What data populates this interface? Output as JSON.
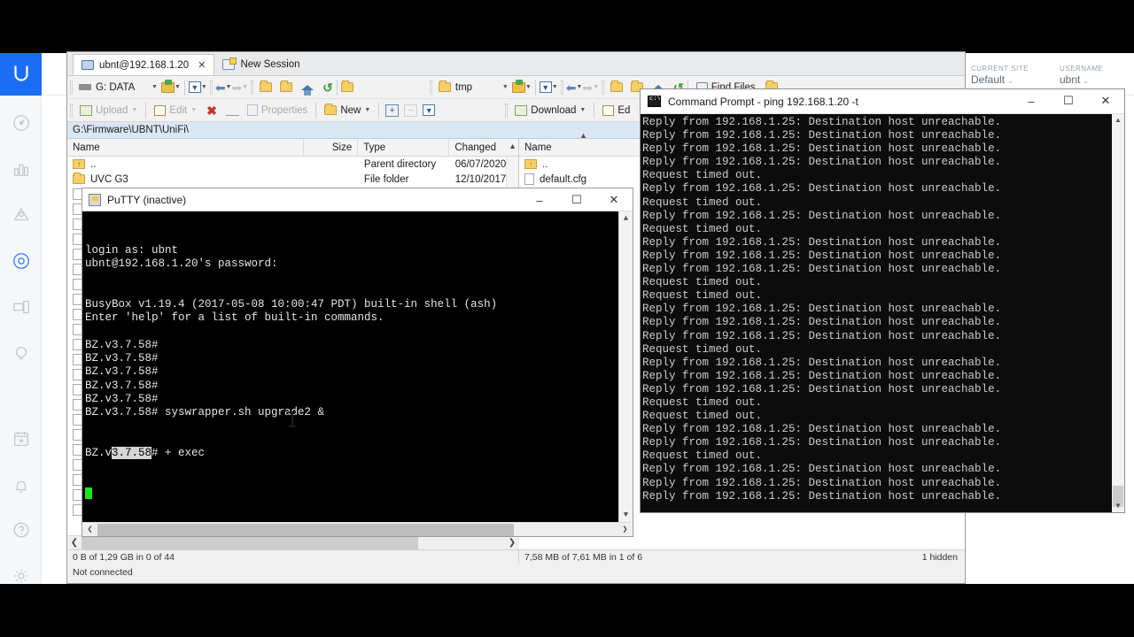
{
  "unifi": {
    "sidebar_icons": [
      "unifi-logo",
      "dashboard-icon",
      "statistics-icon",
      "map-icon",
      "devices-icon",
      "clients-icon",
      "insights-icon",
      "events-icon",
      "alerts-icon",
      "help-icon",
      "settings-icon"
    ],
    "current_site_label": "CURRENT SITE",
    "current_site_value": "Default",
    "username_label": "USERNAME",
    "username_value": "ubnt",
    "caret": "⌄"
  },
  "winscp": {
    "tabs": [
      {
        "label": "ubnt@192.168.1.20",
        "close": "✕",
        "active": true
      },
      {
        "label": "New Session",
        "active": false
      }
    ],
    "toolbar": {
      "left_drive": "G: DATA",
      "right_drive": "tmp",
      "upload_label": "Upload",
      "edit_label": "Edit",
      "properties_label": "Properties",
      "new_label": "New",
      "download_label": "Download",
      "edit_label_right": "Ed",
      "find_files_label": "Find Files"
    },
    "left_path": "G:\\Firmware\\UBNT\\UniFi\\",
    "left_columns": [
      "Name",
      "Size",
      "Type",
      "Changed"
    ],
    "left_rows": [
      {
        "name": "..",
        "size": "",
        "type": "Parent directory",
        "changed": "06/07/2020",
        "icon": "parent-folder-icon"
      },
      {
        "name": "UVC G3",
        "size": "",
        "type": "File folder",
        "changed": "12/10/2017",
        "icon": "folder-icon"
      }
    ],
    "right_columns": [
      "Name"
    ],
    "right_rows": [
      {
        "name": "..",
        "icon": "parent-folder-icon"
      },
      {
        "name": "default.cfg",
        "icon": "file-icon"
      }
    ],
    "status": {
      "left": "0 B of 1,29 GB in 0 of 44",
      "middle": "7,58 MB of 7,61 MB in 1 of 6",
      "right": "1 hidden",
      "connection": "Not connected"
    }
  },
  "putty": {
    "title": "PuTTY (inactive)",
    "window_buttons": [
      "–",
      "☐",
      "✕"
    ],
    "lines": [
      "login as: ubnt",
      "ubnt@192.168.1.20's password:",
      "",
      "",
      "BusyBox v1.19.4 (2017-05-08 10:00:47 PDT) built-in shell (ash)",
      "Enter 'help' for a list of built-in commands.",
      "",
      "BZ.v3.7.58#",
      "BZ.v3.7.58#",
      "BZ.v3.7.58#",
      "BZ.v3.7.58#",
      "BZ.v3.7.58#",
      "BZ.v3.7.58# syswrapper.sh upgrade2 &"
    ],
    "last_line_prefix": "BZ.v",
    "last_line_selected": "3.7.58",
    "last_line_suffix": "# + exec"
  },
  "cmd": {
    "title": "Command Prompt - ping  192.168.1.20 -t",
    "window_buttons": [
      "–",
      "☐",
      "✕"
    ],
    "lines": [
      "Reply from 192.168.1.25: Destination host unreachable.",
      "Reply from 192.168.1.25: Destination host unreachable.",
      "Reply from 192.168.1.25: Destination host unreachable.",
      "Reply from 192.168.1.25: Destination host unreachable.",
      "Request timed out.",
      "Reply from 192.168.1.25: Destination host unreachable.",
      "Request timed out.",
      "Reply from 192.168.1.25: Destination host unreachable.",
      "Request timed out.",
      "Reply from 192.168.1.25: Destination host unreachable.",
      "Reply from 192.168.1.25: Destination host unreachable.",
      "Reply from 192.168.1.25: Destination host unreachable.",
      "Request timed out.",
      "Request timed out.",
      "Reply from 192.168.1.25: Destination host unreachable.",
      "Reply from 192.168.1.25: Destination host unreachable.",
      "Reply from 192.168.1.25: Destination host unreachable.",
      "Request timed out.",
      "Reply from 192.168.1.25: Destination host unreachable.",
      "Reply from 192.168.1.25: Destination host unreachable.",
      "Reply from 192.168.1.25: Destination host unreachable.",
      "Request timed out.",
      "Request timed out.",
      "Reply from 192.168.1.25: Destination host unreachable.",
      "Reply from 192.168.1.25: Destination host unreachable.",
      "Request timed out.",
      "Reply from 192.168.1.25: Destination host unreachable.",
      "Reply from 192.168.1.25: Destination host unreachable.",
      "Reply from 192.168.1.25: Destination host unreachable."
    ]
  }
}
